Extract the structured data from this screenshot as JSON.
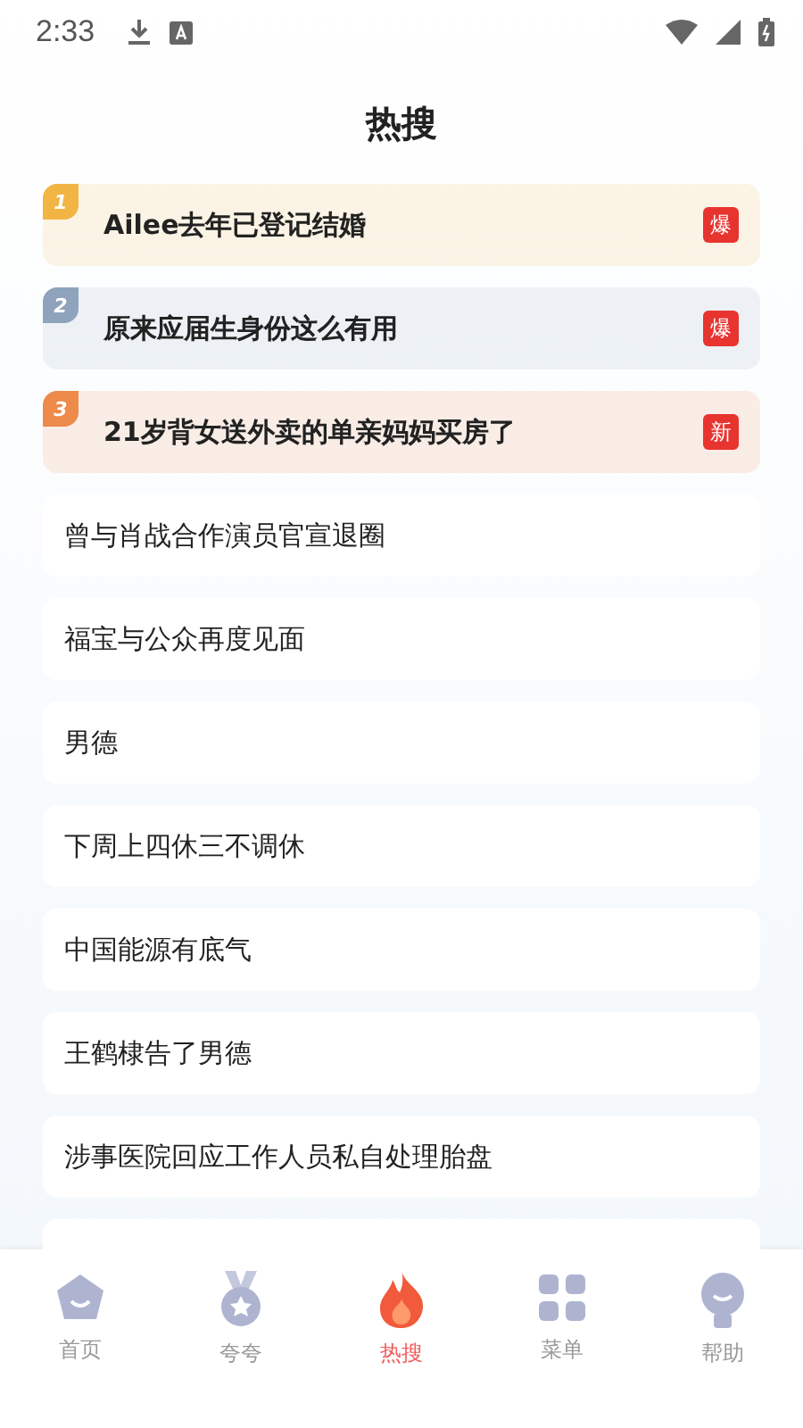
{
  "status_bar": {
    "time": "2:33"
  },
  "title": "热搜",
  "items": [
    {
      "kind": "top",
      "rank": "1",
      "color": "#f2b544",
      "text": "Ailee去年已登记结婚",
      "badge": "爆"
    },
    {
      "kind": "top",
      "rank": "2",
      "color": "#8fa3bd",
      "text": "原来应届生身份这么有用",
      "badge": "爆"
    },
    {
      "kind": "top",
      "rank": "3",
      "color": "#ee8a4a",
      "text": "21岁背女送外卖的单亲妈妈买房了",
      "badge": "新"
    },
    {
      "kind": "plain",
      "text": "曾与肖战合作演员官宣退圈"
    },
    {
      "kind": "plain",
      "text": "福宝与公众再度见面"
    },
    {
      "kind": "plain",
      "text": "男德"
    },
    {
      "kind": "plain",
      "text": "下周上四休三不调休"
    },
    {
      "kind": "plain",
      "text": "中国能源有底气"
    },
    {
      "kind": "plain",
      "text": "王鹤棣告了男德"
    },
    {
      "kind": "plain",
      "text": "涉事医院回应工作人员私自处理胎盘"
    },
    {
      "kind": "peek"
    }
  ],
  "nav": [
    {
      "kind": "home",
      "label": "首页",
      "selected": false
    },
    {
      "kind": "medal",
      "label": "夸夸",
      "selected": false
    },
    {
      "kind": "flame",
      "label": "热搜",
      "selected": true
    },
    {
      "kind": "grid",
      "label": "菜单",
      "selected": false
    },
    {
      "kind": "person",
      "label": "帮助",
      "selected": false
    }
  ]
}
